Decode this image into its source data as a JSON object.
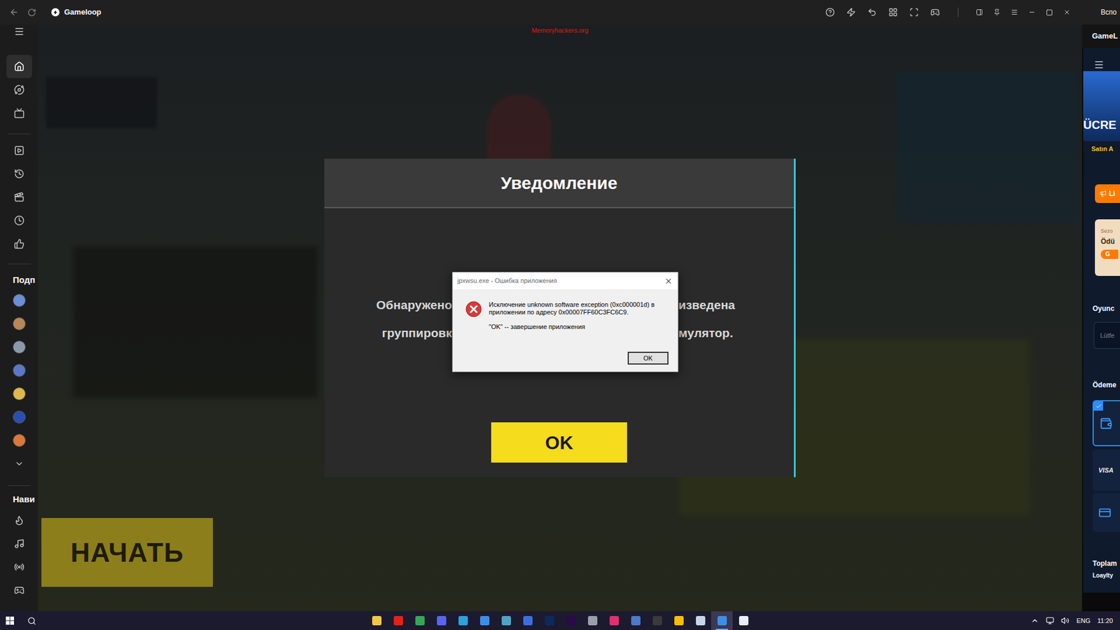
{
  "window": {
    "title": "Gameloop",
    "watermark": "Memoryhackers.org"
  },
  "sidebar": {
    "top_items": [
      {
        "selected": true
      },
      {
        "selected": false
      },
      {
        "selected": false
      }
    ],
    "mid_items": [
      {
        "selected": false
      },
      {
        "selected": false
      },
      {
        "selected": false
      },
      {
        "selected": false
      },
      {
        "selected": false
      }
    ],
    "subscriptions_label": "Подп",
    "avatars": [
      {
        "color": "#6b8fd6"
      },
      {
        "color": "#b8865a"
      },
      {
        "color": "#8a9aa8"
      },
      {
        "color": "#5a78c8"
      },
      {
        "color": "#e0b84a"
      },
      {
        "color": "#2a4fb0"
      },
      {
        "color": "#d9783a"
      }
    ],
    "nav_label": "Нави",
    "nav_items": [
      {
        "selected": false
      },
      {
        "selected": false
      },
      {
        "selected": false
      },
      {
        "selected": false
      }
    ]
  },
  "game": {
    "start_button": "НАЧАТЬ",
    "notice": {
      "title": "Уведомление",
      "lines": [
        {
          "left": "Обнаружено",
          "right": "изведена"
        },
        {
          "left": "группировк",
          "right": "мулятор."
        }
      ],
      "button": "OK"
    }
  },
  "error_dialog": {
    "title": "jpxwsu.exe - Ошибка приложения",
    "message": "Исключение unknown software exception (0xc000001d) в приложении по адресу 0x00007FF60C3FC6C9.",
    "note": "\"OK\" -- завершение приложения",
    "button": "OK"
  },
  "side_window": {
    "menu": "Вспо",
    "app": "GameL",
    "banner": "ÜCRE",
    "buy": "Satın A",
    "promo_button": "Li",
    "season_card": {
      "label": "Sezo",
      "title": "Ödü",
      "button": "G"
    },
    "player_label": "Oyunc",
    "input_placeholder": "Lütfe",
    "payment_label": "Ödeme",
    "payment_methods": [
      {
        "kind": "wallet",
        "selected": true
      },
      {
        "kind": "visa",
        "label": "VISA",
        "selected": false
      },
      {
        "kind": "transfer",
        "selected": false
      }
    ],
    "total_label": "Toplam",
    "loyalty_label": "Loaylty"
  },
  "taskbar": {
    "apps": [
      {
        "color": "#f2c744",
        "selected": false
      },
      {
        "color": "#e62117",
        "selected": false
      },
      {
        "color": "#34a853",
        "selected": false
      },
      {
        "color": "#5865f2",
        "selected": false
      },
      {
        "color": "#2aa3e0",
        "selected": false
      },
      {
        "color": "#3d8ee8",
        "selected": false
      },
      {
        "color": "#4fa3c7",
        "selected": false
      },
      {
        "color": "#3a6fe0",
        "selected": false
      },
      {
        "color": "#0a2a5e",
        "selected": false
      },
      {
        "color": "#2a0a4a",
        "selected": false
      },
      {
        "color": "#9aa0a8",
        "selected": false
      },
      {
        "color": "#e1306c",
        "selected": false
      },
      {
        "color": "#4a7ac8",
        "selected": false
      },
      {
        "color": "#3a3a3a",
        "selected": false
      },
      {
        "color": "#fbbc05",
        "selected": false
      },
      {
        "color": "#c8d4ec",
        "selected": false
      },
      {
        "color": "#3b8fe8",
        "selected": true
      },
      {
        "color": "#e8eef8",
        "selected": false
      }
    ],
    "language": "ENG",
    "time": "11:20"
  }
}
